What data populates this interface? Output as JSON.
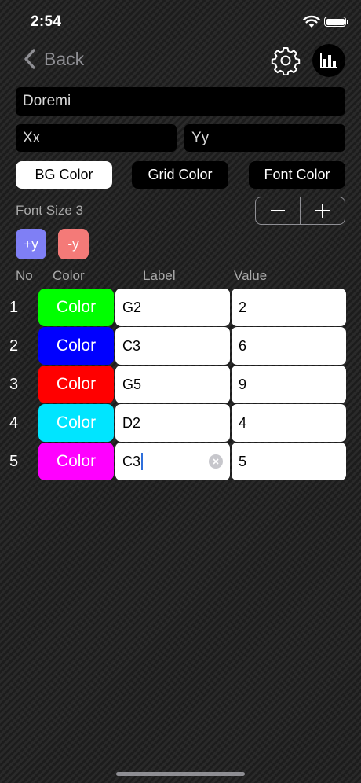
{
  "status": {
    "time": "2:54"
  },
  "nav": {
    "back_label": "Back"
  },
  "icons": {
    "back": "chevron-left-icon",
    "settings": "gear-icon",
    "chart": "bar-chart-icon",
    "wifi": "wifi-icon",
    "battery": "battery-icon"
  },
  "form": {
    "title_value": "Doremi",
    "x_label_value": "Xx",
    "y_label_value": "Yy"
  },
  "buttons": {
    "bg_color": "BG Color",
    "grid_color": "Grid Color",
    "font_color": "Font Color",
    "plus_y": "+y",
    "minus_y": "-y"
  },
  "font_size": {
    "label": "Font Size 3",
    "decrement": "−",
    "increment": "+"
  },
  "table": {
    "headers": {
      "no": "No",
      "color": "Color",
      "label": "Label",
      "value": "Value"
    },
    "color_button_label": "Color",
    "rows": [
      {
        "no": "1",
        "color": "#00ff00",
        "text_color": "#ffffff",
        "label": "G2",
        "value": "2"
      },
      {
        "no": "2",
        "color": "#0000ff",
        "text_color": "#ffffff",
        "label": "C3",
        "value": "6"
      },
      {
        "no": "3",
        "color": "#ff0000",
        "text_color": "#ffffff",
        "label": "G5",
        "value": "9"
      },
      {
        "no": "4",
        "color": "#00e5ff",
        "text_color": "#ffffff",
        "label": "D2",
        "value": "4"
      },
      {
        "no": "5",
        "color": "#ff00ff",
        "text_color": "#ffffff",
        "label": "C3",
        "value": "5"
      }
    ]
  },
  "colors": {
    "accent_plus": "#7f7ff5",
    "accent_minus": "#f47a78"
  }
}
